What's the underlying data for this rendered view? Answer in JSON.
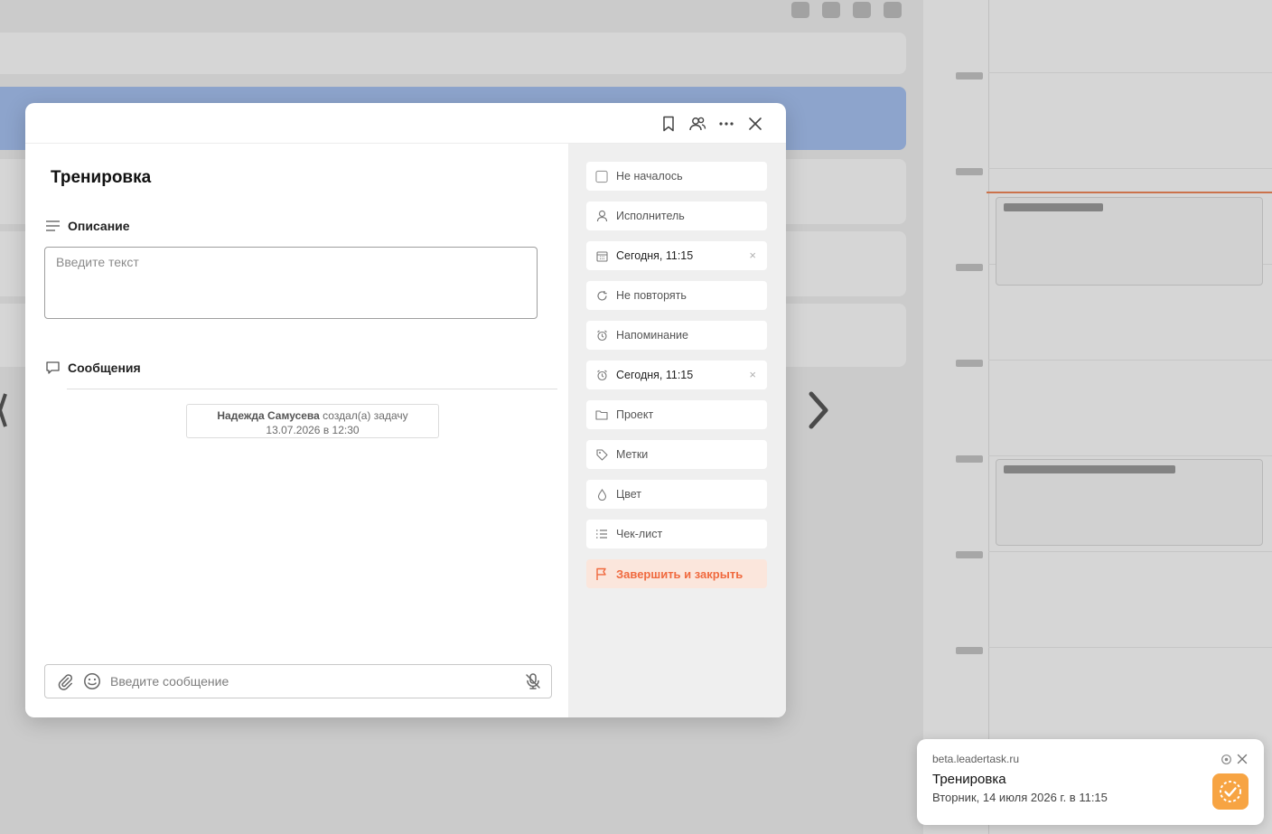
{
  "task": {
    "title": "Тренировка",
    "description_label": "Описание",
    "description_placeholder": "Введите текст",
    "messages_label": "Сообщения",
    "created_author": "Надежда Самусева",
    "created_action": "создал(а) задачу",
    "created_date": "13.07.2026 в 12:30",
    "message_placeholder": "Введите сообщение"
  },
  "properties": {
    "status": "Не началось",
    "assignee": "Исполнитель",
    "date": "Сегодня, 11:15",
    "repeat": "Не повторять",
    "reminder_label": "Напоминание",
    "reminder_value": "Сегодня, 11:15",
    "project": "Проект",
    "tags": "Метки",
    "color": "Цвет",
    "checklist": "Чек-лист",
    "finish": "Завершить и закрыть",
    "clear_symbol": "×"
  },
  "notification": {
    "site": "beta.leadertask.ru",
    "title": "Тренировка",
    "text": "Вторник, 14 июля 2026 г. в 11:15"
  },
  "colors": {
    "accent": "#f06a3f",
    "accent_bg": "#fbe6dc",
    "notification_logo": "#f7a443",
    "now_line": "#f2885a"
  }
}
